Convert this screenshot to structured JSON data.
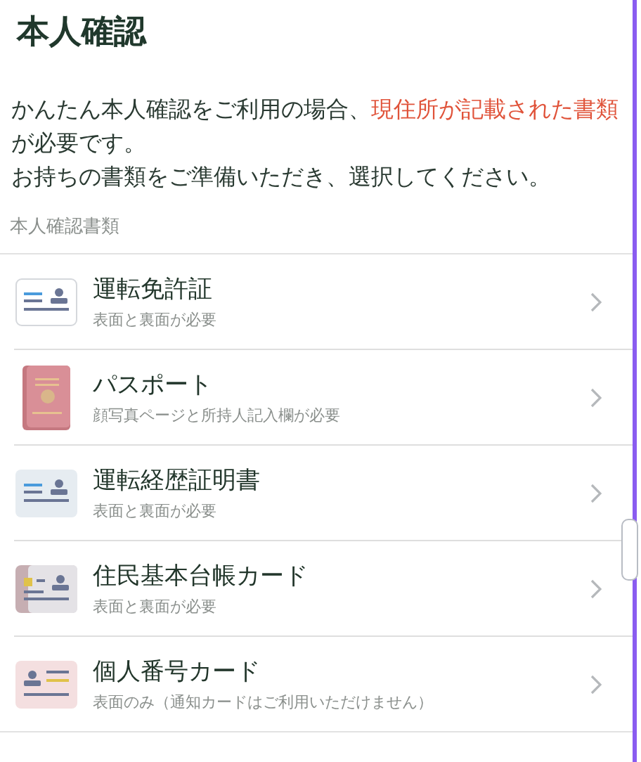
{
  "title": "本人確認",
  "intro": [
    {
      "text": "かんたん本人確認をご利用の場合、",
      "highlight": false
    },
    {
      "text": "現住所が記載された書類",
      "highlight": true
    },
    {
      "text": "が必要です。",
      "highlight": false
    }
  ],
  "instruction": "お持ちの書類をご準備いただき、選択してください。",
  "section_label": "本人確認書類",
  "documents": [
    {
      "kind": "license",
      "name": "運転免許証",
      "note": "表面と裏面が必要"
    },
    {
      "kind": "passport",
      "name": "パスポート",
      "note": "顔写真ページと所持人記入欄が必要"
    },
    {
      "kind": "history",
      "name": "運転経歴証明書",
      "note": "表面と裏面が必要"
    },
    {
      "kind": "resident",
      "name": "住民基本台帳カード",
      "note": "表面と裏面が必要"
    },
    {
      "kind": "mynumber",
      "name": "個人番号カード",
      "note": "表面のみ（通知カードはご利用いただけません）"
    }
  ]
}
